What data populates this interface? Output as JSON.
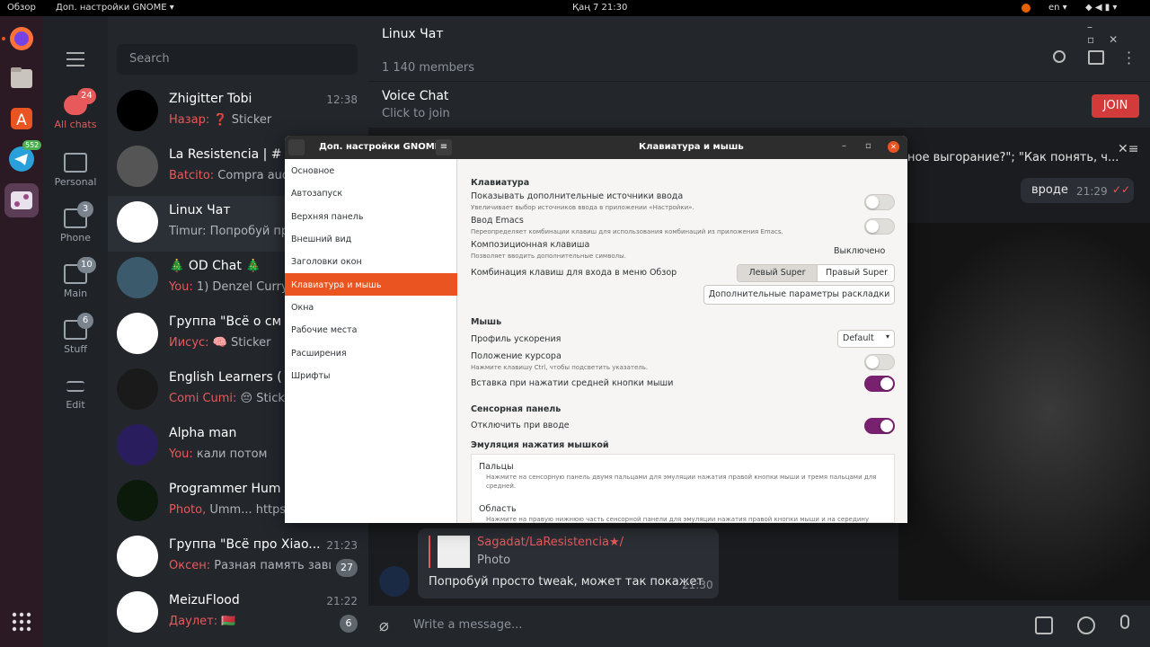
{
  "topbar": {
    "overview": "Обзор",
    "app_menu": "Доп. настройки GNOME ▾",
    "clock": "Қаң 7  21:30",
    "lang": "en ▾"
  },
  "dock": {
    "telegram_badge": "552"
  },
  "folders": [
    {
      "label": "All chats",
      "badge": "24",
      "icon": "chat-bubbles-icon"
    },
    {
      "label": "Personal",
      "badge": "",
      "icon": "folder-icon"
    },
    {
      "label": "Phone",
      "badge": "3",
      "icon": "folder-icon"
    },
    {
      "label": "Main",
      "badge": "10",
      "icon": "folder-icon"
    },
    {
      "label": "Stuff",
      "badge": "6",
      "icon": "folder-icon"
    },
    {
      "label": "Edit",
      "badge": "",
      "icon": "sliders-icon"
    }
  ],
  "chatlist": {
    "search_placeholder": "Search",
    "chats": [
      {
        "name": "Zhigitter Tobi",
        "sender": "Назар:",
        "msg": " ❓ Sticker",
        "time": "12:38",
        "count": ""
      },
      {
        "name": "La Resistencia | #",
        "sender": "Batcito:",
        "msg": " Compra audif",
        "time": "",
        "count": ""
      },
      {
        "name": "Linux Чат",
        "sender": "",
        "msg": "Timur: Попробуй про",
        "time": "",
        "count": ""
      },
      {
        "name": "🎄 OD Chat 🎄",
        "sender": "You:",
        "msg": " 1) Denzel Curry 2",
        "time": "",
        "count": ""
      },
      {
        "name": "Группа \"Всё о см",
        "sender": "Иисус:",
        "msg": " 🧠 Sticker",
        "time": "",
        "count": ""
      },
      {
        "name": "English Learners (",
        "sender": "Comi Cumi:",
        "msg": " 😔 Sticke",
        "time": "",
        "count": ""
      },
      {
        "name": "Alpha man",
        "sender": "You:",
        "msg": " кали потом",
        "time": "",
        "count": ""
      },
      {
        "name": "Programmer Hum",
        "sender": "Photo,",
        "msg": " Umm... https:/",
        "time": "",
        "count": ""
      },
      {
        "name": "Группа \"Всё про Xiao...",
        "sender": "Оксен:",
        "msg": " Разная память зави...",
        "time": "21:23",
        "count": "27"
      },
      {
        "name": "MeizuFlood",
        "sender": "Даулет:",
        "msg": " 🇧🇾",
        "time": "21:22",
        "count": "6"
      }
    ]
  },
  "chat": {
    "title": "Linux Чат",
    "members": "1 140 members",
    "voice_title": "Voice Chat",
    "voice_sub": "Click to join",
    "join": "JOIN",
    "partial_msg": "ное выгорание?\"; \"Как понять, ч...",
    "msg_vrode": "вроде",
    "msg_vrode_time": "21:29",
    "reply_author": "Sagadat/LaResistencia★/",
    "reply_text": "Photo",
    "last_msg": "Попробуй просто tweak, может так покажет",
    "last_time": "21:30",
    "composer_placeholder": "Write a message..."
  },
  "dialog": {
    "app_title": "Доп. настройки GNOME",
    "page_title": "Клавиатура и мышь",
    "sidebar": [
      "Основное",
      "Автозапуск",
      "Верхняя панель",
      "Внешний вид",
      "Заголовки окон",
      "Клавиатура и мышь",
      "Окна",
      "Рабочие места",
      "Расширения",
      "Шрифты"
    ],
    "sec_keyboard": "Клавиатура",
    "show_sources": "Показывать дополнительные источники ввода",
    "show_sources_sub": "Увеличивает выбор источников ввода в приложении «Настройки».",
    "emacs": "Ввод Emacs",
    "emacs_sub": "Переопределяет комбинации клавиш для использования комбинаций из приложения Emacs.",
    "compose": "Композиционная клавиша",
    "compose_sub": "Позволяет вводить дополнительные символы.",
    "compose_value": "Выключено",
    "overview_combo": "Комбинация клавиш для входа в меню Обзор",
    "left_super": "Левый Super",
    "right_super": "Правый Super",
    "layout_btn": "Дополнительные параметры раскладки",
    "sec_mouse": "Мышь",
    "accel": "Профиль ускорения",
    "accel_value": "Default",
    "cursor_pos": "Положение курсора",
    "cursor_pos_sub": "Нажмите клавишу Ctrl, чтобы подсветить указатель.",
    "middle_paste": "Вставка при нажатии средней кнопки мыши",
    "sec_touchpad": "Сенсорная панель",
    "disable_typing": "Отключить при вводе",
    "sec_emul": "Эмуляция нажатия мышкой",
    "fingers": "Пальцы",
    "fingers_sub": "Нажмите на сенсорную панель двумя пальцами для эмуляции нажатия правой кнопки мыши и тремя пальцами для",
    "fingers_sub2": "средней.",
    "area": "Область",
    "area_sub": "Нажмите на правую нижнюю часть сенсорной панели для эмуляции нажатия правой кнопки мыши и на середину"
  }
}
